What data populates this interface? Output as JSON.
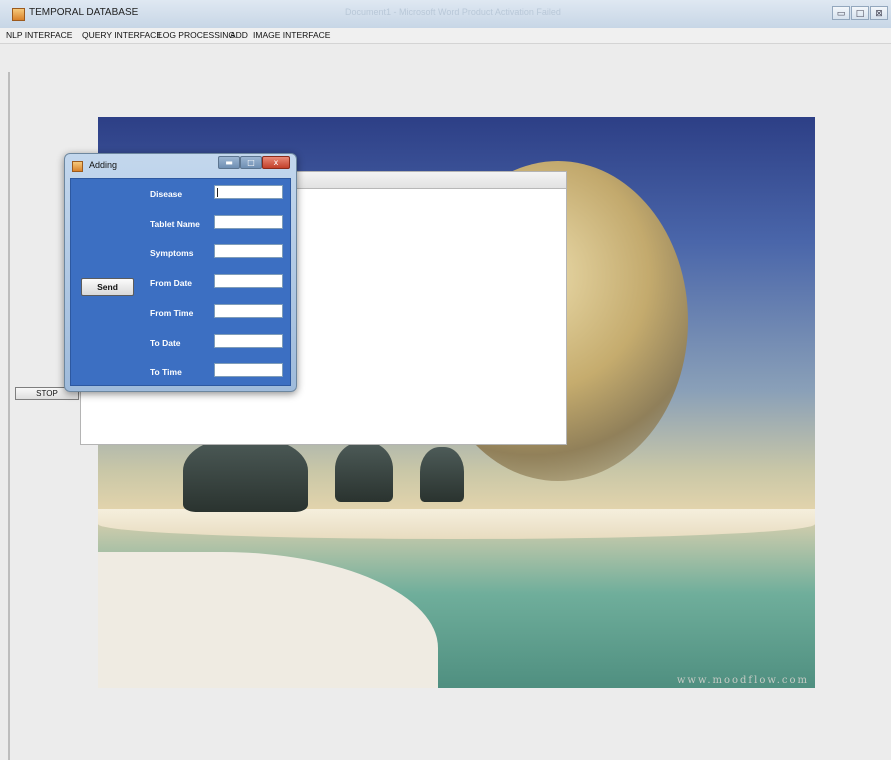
{
  "window": {
    "title": "TEMPORAL DATABASE",
    "background_title": "Document1 - Microsoft Word Product Activation Failed",
    "controls": {
      "minimize": "▭",
      "maximize": "□",
      "close": "⊠"
    }
  },
  "menu": {
    "items": [
      "NLP INTERFACE",
      "QUERY INTERFACE",
      "LOG PROCESSING",
      "ADD",
      "IMAGE INTERFACE"
    ]
  },
  "background": {
    "watermark": "www.moodflow.com"
  },
  "main": {
    "stop_label": "STOP"
  },
  "dialog": {
    "title": "Adding",
    "send_label": "Send",
    "fields": [
      {
        "label": "Disease",
        "value": ""
      },
      {
        "label": "Tablet Name",
        "value": ""
      },
      {
        "label": "Symptoms",
        "value": ""
      },
      {
        "label": "From Date",
        "value": ""
      },
      {
        "label": "From Time",
        "value": ""
      },
      {
        "label": "To Date",
        "value": ""
      },
      {
        "label": "To Time",
        "value": ""
      }
    ]
  },
  "colors": {
    "dialog_body": "#3c6fc2",
    "title_bar": "#c7d6e6",
    "panel": "#ffffff"
  }
}
